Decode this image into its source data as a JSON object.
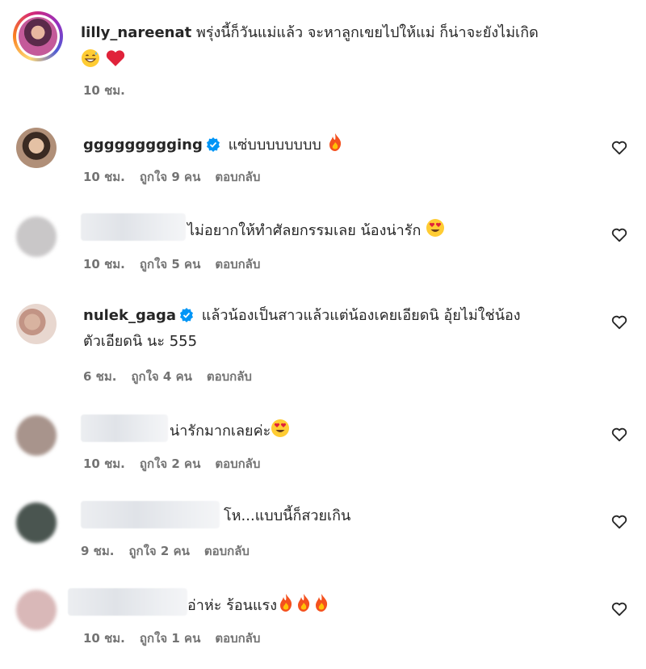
{
  "comments": [
    {
      "username": "lilly_nareenat",
      "text_line1": "พรุ่งนี้ก็วันแม่แล้ว จะหาลูกเขยไปให้แม่ ก็น่าจะยังไม่เกิด",
      "text_line2_emojis": [
        "grinning-sweat-emoji",
        "red-heart-emoji"
      ],
      "time": "10 ชม.",
      "likes": "",
      "reply": "",
      "verified": false
    },
    {
      "username": "ggggggggging",
      "text": "แซ่บบบบบบบบ",
      "emojis": [
        "fire-emoji"
      ],
      "time": "10 ชม.",
      "likes": "ถูกใจ 9 คน",
      "reply": "ตอบกลับ",
      "verified": true
    },
    {
      "username": "",
      "text": "ไม่อยากให้ทำศัลยกรรมเลย น้องน่ารัก",
      "emojis": [
        "heart-eyes-emoji"
      ],
      "time": "10 ชม.",
      "likes": "ถูกใจ 5 คน",
      "reply": "ตอบกลับ",
      "verified": false
    },
    {
      "username": "nulek_gaga",
      "text_line1": "แล้วน้องเป็นสาวแล้วแต่น้องเคยเอียดนิ อุ้ยไม่ใช่น้อง",
      "text_line2": "ตัวเอียดนิ นะ 555",
      "time": "6 ชม.",
      "likes": "ถูกใจ 4 คน",
      "reply": "ตอบกลับ",
      "verified": true
    },
    {
      "username": "",
      "text": "น่ารักมากเลยค่ะ",
      "emojis": [
        "heart-eyes-emoji"
      ],
      "time": "10 ชม.",
      "likes": "ถูกใจ 2 คน",
      "reply": "ตอบกลับ",
      "verified": false
    },
    {
      "username": "",
      "text": "โห...แบบนี้ก็สวยเกิน",
      "emojis": [],
      "time": "9 ชม.",
      "likes": "ถูกใจ 2 คน",
      "reply": "ตอบกลับ",
      "verified": false
    },
    {
      "username": "",
      "text": "อ่าห่ะ ร้อนแรง",
      "emojis": [
        "fire-emoji",
        "fire-emoji",
        "fire-emoji"
      ],
      "time": "10 ชม.",
      "likes": "ถูกใจ 1 คน",
      "reply": "ตอบกลับ",
      "verified": false
    }
  ],
  "colors": {
    "text": "#262626",
    "meta": "#737373",
    "verified": "#0095f6"
  }
}
